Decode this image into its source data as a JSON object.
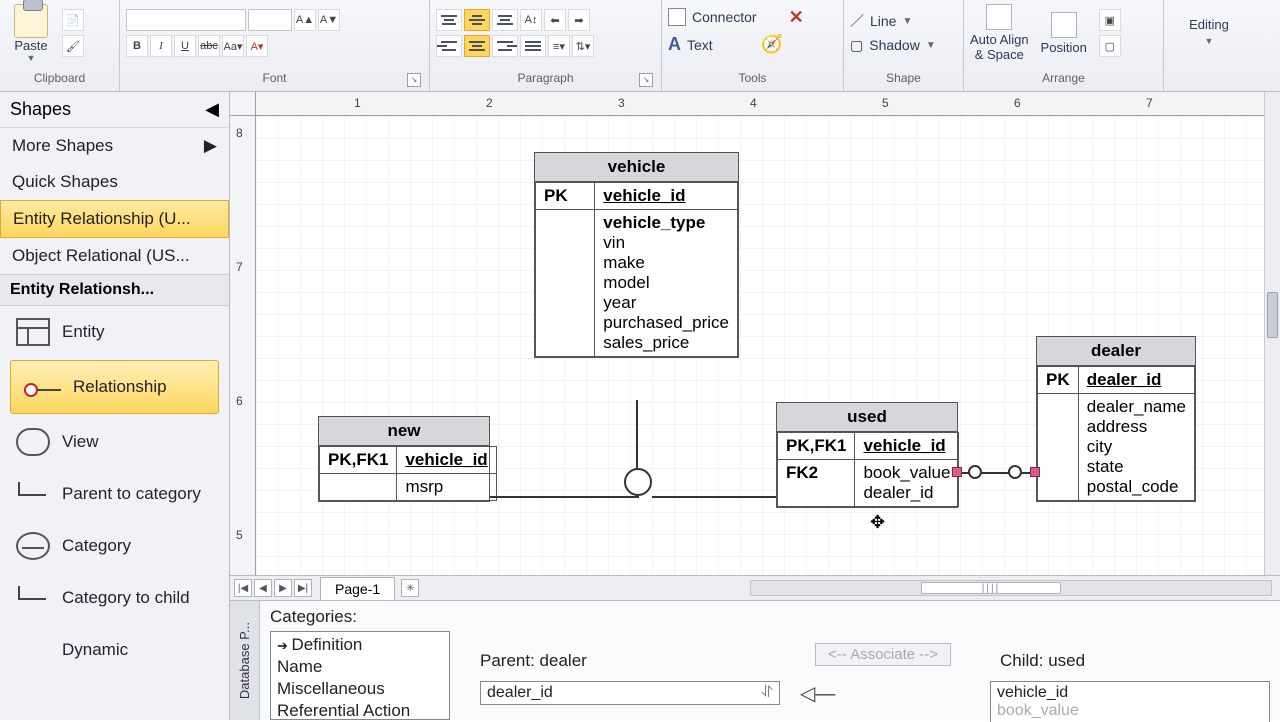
{
  "ribbon": {
    "clipboard": {
      "label": "Clipboard",
      "paste": "Paste"
    },
    "font": {
      "label": "Font"
    },
    "paragraph": {
      "label": "Paragraph"
    },
    "tools": {
      "label": "Tools",
      "connector": "Connector",
      "text": "Text"
    },
    "shape": {
      "label": "Shape",
      "line": "Line",
      "shadow": "Shadow"
    },
    "arrange": {
      "label": "Arrange",
      "auto": "Auto Align\n& Space",
      "position": "Position"
    },
    "editing": {
      "label": "Editing"
    }
  },
  "side": {
    "header": "Shapes",
    "more": "More Shapes",
    "quick": "Quick Shapes",
    "er": "Entity Relationship (U...",
    "or": "Object Relational (US...",
    "stencil_hdr": "Entity Relationsh...",
    "items": {
      "entity": "Entity",
      "relationship": "Relationship",
      "view": "View",
      "p2c": "Parent to category",
      "category": "Category",
      "c2c": "Category to child",
      "dynamic": "Dynamic"
    }
  },
  "ruler_h": [
    "1",
    "2",
    "3",
    "4",
    "5",
    "6",
    "7"
  ],
  "ruler_v": [
    "8",
    "7",
    "6",
    "5"
  ],
  "entities": {
    "vehicle": {
      "title": "vehicle",
      "pk_lbl": "PK",
      "pk": "vehicle_id",
      "attrs": [
        "vehicle_type",
        "vin",
        "make",
        "model",
        "year",
        "purchased_price",
        "sales_price"
      ]
    },
    "new": {
      "title": "new",
      "pk_lbl": "PK,FK1",
      "pk": "vehicle_id",
      "attr_lbl": "",
      "attr": "msrp"
    },
    "used": {
      "title": "used",
      "pk_lbl": "PK,FK1",
      "pk": "vehicle_id",
      "fk_lbl": "FK2",
      "attrs": [
        "book_value",
        "dealer_id"
      ]
    },
    "dealer": {
      "title": "dealer",
      "pk_lbl": "PK",
      "pk": "dealer_id",
      "attrs": [
        "dealer_name",
        "address",
        "city",
        "state",
        "postal_code"
      ]
    }
  },
  "tabs": {
    "page": "Page-1"
  },
  "dbpane": {
    "tab": "Database P...",
    "caption": "Categories:",
    "cats": [
      "Definition",
      "Name",
      "Miscellaneous",
      "Referential Action"
    ],
    "parent_lbl": "Parent: ",
    "parent_val": "dealer",
    "child_lbl": "Child: ",
    "child_val": "used",
    "assoc": "<-- Associate -->",
    "parent_field": "dealer_id",
    "child_fields": [
      "vehicle_id",
      "book_value"
    ]
  }
}
